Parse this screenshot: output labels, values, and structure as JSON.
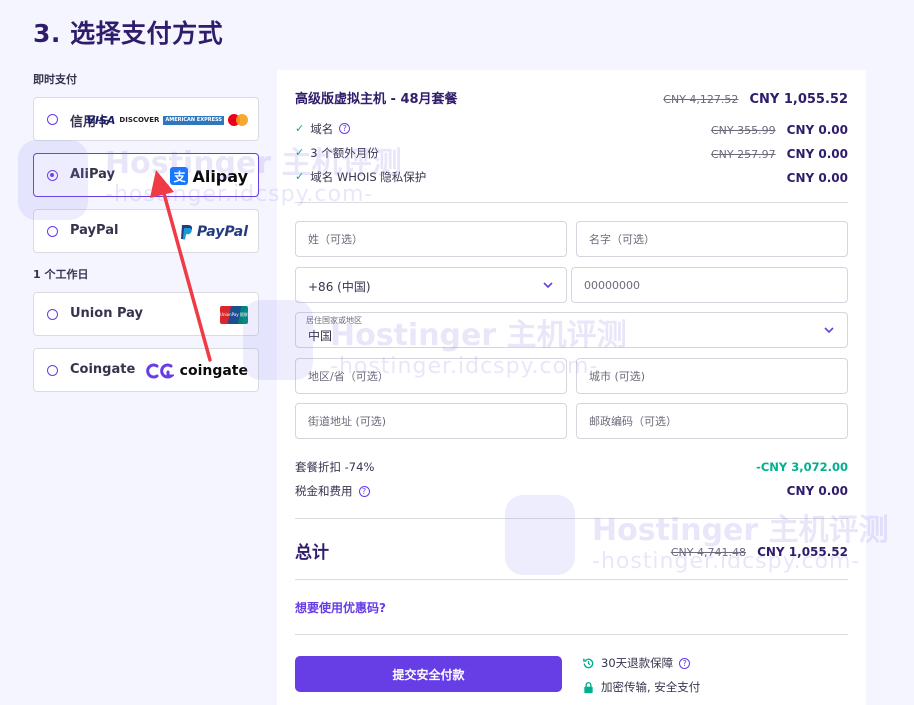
{
  "title": "3. 选择支付方式",
  "sections": {
    "instant": "即时支付",
    "workday": "1 个工作日"
  },
  "payment_options": [
    {
      "id": "credit-card",
      "label": "信用卡",
      "selected": false,
      "logo": "VISA · DISCOVER · AMEX · Mastercard"
    },
    {
      "id": "alipay",
      "label": "AliPay",
      "selected": true,
      "logo": "Alipay"
    },
    {
      "id": "paypal",
      "label": "PayPal",
      "selected": false,
      "logo": "PayPal"
    },
    {
      "id": "unionpay",
      "label": "Union Pay",
      "selected": false,
      "logo": "UnionPay"
    },
    {
      "id": "coingate",
      "label": "Coingate",
      "selected": false,
      "logo": "coingate"
    }
  ],
  "logo_text": {
    "visa": "VISA",
    "discover": "DISCOVER",
    "amex": "AMERICAN EXPRESS",
    "alipay_char": "支",
    "alipay": "Alipay",
    "paypal": "PayPal",
    "unionpay": "UnionPay 银联",
    "coingate": "coingate"
  },
  "order": {
    "plan": {
      "name": "高级版虚拟主机 - 48月套餐",
      "old_price": "CNY 4,127.52",
      "price": "CNY 1,055.52"
    },
    "items": [
      {
        "name": "域名",
        "old_price": "CNY 355.99",
        "price": "CNY 0.00",
        "help": true
      },
      {
        "name": "3 个额外月份",
        "old_price": "CNY 257.97",
        "price": "CNY 0.00",
        "help": false
      },
      {
        "name": "域名 WHOIS 隐私保护",
        "old_price": "",
        "price": "CNY 0.00",
        "help": false
      }
    ]
  },
  "form": {
    "last_name_placeholder": "姓（可选）",
    "first_name_placeholder": "名字（可选）",
    "phone_code": "+86 (中国)",
    "phone_placeholder": "00000000",
    "country_label": "居住国家或地区",
    "country_value": "中国",
    "region_placeholder": "地区/省（可选）",
    "city_placeholder": "城市 (可选)",
    "street_placeholder": "街道地址 (可选)",
    "zip_placeholder": "邮政编码（可选）"
  },
  "summary": {
    "discount_label": "套餐折扣 -74%",
    "discount_value": "-CNY 3,072.00",
    "tax_label": "税金和费用",
    "tax_value": "CNY 0.00",
    "total_label": "总计",
    "total_old": "CNY 4,741.48",
    "total_value": "CNY 1,055.52"
  },
  "promo_link": "想要使用优惠码?",
  "submit_label": "提交安全付款",
  "assurances": [
    {
      "text": "30天退款保障",
      "icon": "refund-clock-icon"
    },
    {
      "text": "加密传输, 安全支付",
      "icon": "lock-icon"
    }
  ],
  "watermark": {
    "brand": "Hostinger 主机评测",
    "url": "-hostinger.idcspy.com-"
  },
  "colors": {
    "accent": "#673de6",
    "heading": "#2f1c6a",
    "success": "#00b090",
    "arrow": "#ef3b45"
  }
}
